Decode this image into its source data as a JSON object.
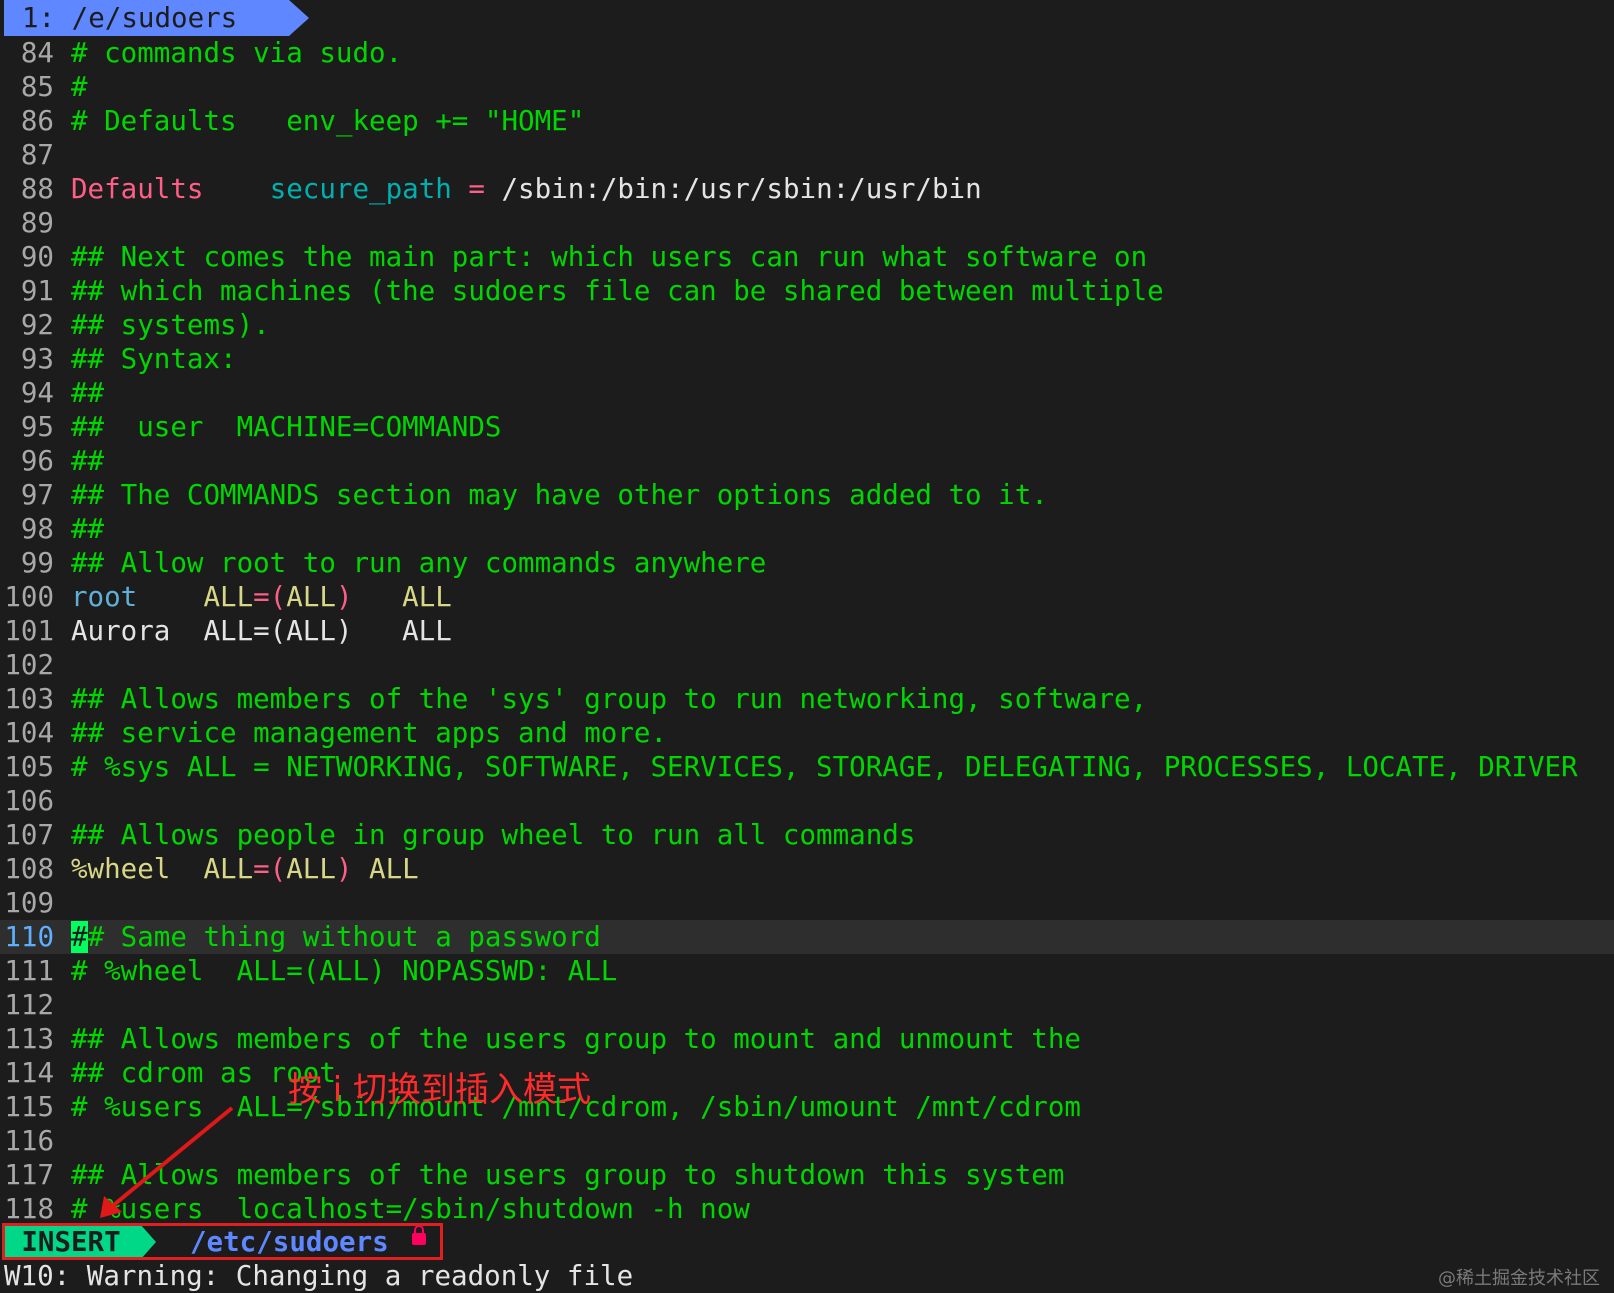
{
  "tabline": {
    "tab_label": "1: /e/sudoers"
  },
  "editor": {
    "cursor_line": "110",
    "lines": [
      {
        "n": "84",
        "segs": [
          [
            "t-comment",
            "# commands via sudo."
          ]
        ]
      },
      {
        "n": "85",
        "segs": [
          [
            "t-comment",
            "#"
          ]
        ]
      },
      {
        "n": "86",
        "segs": [
          [
            "t-comment",
            "# Defaults   env_keep += \"HOME\""
          ]
        ]
      },
      {
        "n": "87",
        "segs": []
      },
      {
        "n": "88",
        "segs": [
          [
            "t-kw",
            "Defaults"
          ],
          [
            "t-plain",
            "    "
          ],
          [
            "t-id",
            "secure_path"
          ],
          [
            "t-plain",
            " "
          ],
          [
            "t-op",
            "="
          ],
          [
            "t-path",
            " /sbin:/bin:/usr/sbin:/usr/bin"
          ]
        ]
      },
      {
        "n": "89",
        "segs": []
      },
      {
        "n": "90",
        "segs": [
          [
            "t-comment",
            "## Next comes the main part: which users can run what software on"
          ]
        ]
      },
      {
        "n": "91",
        "segs": [
          [
            "t-comment",
            "## which machines (the sudoers file can be shared between multiple"
          ]
        ]
      },
      {
        "n": "92",
        "segs": [
          [
            "t-comment",
            "## systems)."
          ]
        ]
      },
      {
        "n": "93",
        "segs": [
          [
            "t-comment",
            "## Syntax:"
          ]
        ]
      },
      {
        "n": "94",
        "segs": [
          [
            "t-comment",
            "##"
          ]
        ]
      },
      {
        "n": "95",
        "segs": [
          [
            "t-comment",
            "##  user  MACHINE=COMMANDS"
          ]
        ]
      },
      {
        "n": "96",
        "segs": [
          [
            "t-comment",
            "##"
          ]
        ]
      },
      {
        "n": "97",
        "segs": [
          [
            "t-comment",
            "## The COMMANDS section may have other options added to it."
          ]
        ]
      },
      {
        "n": "98",
        "segs": [
          [
            "t-comment",
            "##"
          ]
        ]
      },
      {
        "n": "99",
        "segs": [
          [
            "t-comment",
            "## Allow root to run any commands anywhere"
          ]
        ]
      },
      {
        "n": "100",
        "segs": [
          [
            "t-user",
            "root"
          ],
          [
            "t-plain",
            "    "
          ],
          [
            "t-all",
            "ALL"
          ],
          [
            "t-op",
            "=("
          ],
          [
            "t-all",
            "ALL"
          ],
          [
            "t-op",
            ")"
          ],
          [
            "t-plain",
            "   "
          ],
          [
            "t-all",
            "ALL"
          ]
        ]
      },
      {
        "n": "101",
        "segs": [
          [
            "t-plain",
            "Aurora  ALL=(ALL)   ALL"
          ]
        ]
      },
      {
        "n": "102",
        "segs": []
      },
      {
        "n": "103",
        "segs": [
          [
            "t-comment",
            "## Allows members of the 'sys' group to run networking, software,"
          ]
        ]
      },
      {
        "n": "104",
        "segs": [
          [
            "t-comment",
            "## service management apps and more."
          ]
        ]
      },
      {
        "n": "105",
        "segs": [
          [
            "t-comment",
            "# %sys ALL = NETWORKING, SOFTWARE, SERVICES, STORAGE, DELEGATING, PROCESSES, LOCATE, DRIVER"
          ]
        ]
      },
      {
        "n": "106",
        "segs": []
      },
      {
        "n": "107",
        "segs": [
          [
            "t-comment",
            "## Allows people in group wheel to run all commands"
          ]
        ]
      },
      {
        "n": "108",
        "segs": [
          [
            "t-all",
            "%wheel  ALL"
          ],
          [
            "t-op",
            "=("
          ],
          [
            "t-all",
            "ALL"
          ],
          [
            "t-op",
            ")"
          ],
          [
            "t-all",
            " ALL"
          ]
        ]
      },
      {
        "n": "109",
        "segs": []
      },
      {
        "n": "110",
        "segs": [
          [
            "cursor",
            "#"
          ],
          [
            "t-comment",
            "# Same thing without a password"
          ]
        ]
      },
      {
        "n": "111",
        "segs": [
          [
            "t-comment",
            "# %wheel  ALL=(ALL) NOPASSWD: ALL"
          ]
        ]
      },
      {
        "n": "112",
        "segs": []
      },
      {
        "n": "113",
        "segs": [
          [
            "t-comment",
            "## Allows members of the users group to mount and unmount the"
          ]
        ]
      },
      {
        "n": "114",
        "segs": [
          [
            "t-comment",
            "## cdrom as root"
          ]
        ]
      },
      {
        "n": "115",
        "segs": [
          [
            "t-comment",
            "# %users  ALL=/sbin/mount /mnt/cdrom, /sbin/umount /mnt/cdrom"
          ]
        ]
      },
      {
        "n": "116",
        "segs": []
      },
      {
        "n": "117",
        "segs": [
          [
            "t-comment",
            "## Allows members of the users group to shutdown this system"
          ]
        ]
      },
      {
        "n": "118",
        "segs": [
          [
            "t-comment",
            "# %users  localhost=/sbin/shutdown -h now"
          ]
        ]
      }
    ]
  },
  "statusline": {
    "mode": "INSERT",
    "filename": "/etc/sudoers",
    "lock_icon": "lock-icon",
    "colors": {
      "mode_bg": "#00d787",
      "filename": "#5f87ff",
      "lock": "#ff005f"
    }
  },
  "message": "W10: Warning: Changing a readonly file",
  "annotation": {
    "text": "按 i 切换到插入模式",
    "color": "#ff2a2a"
  },
  "watermark": "@稀土掘金技术社区"
}
